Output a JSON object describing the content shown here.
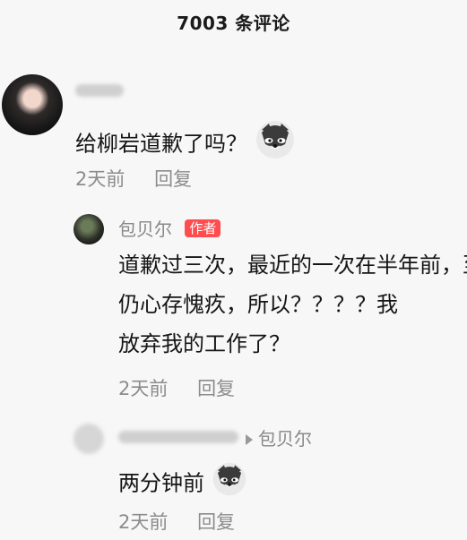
{
  "header": {
    "title": "7003 条评论"
  },
  "comments": [
    {
      "text": "给柳岩道歉了吗？",
      "time": "2天前",
      "reply_label": "回复"
    }
  ],
  "author_reply": {
    "name": "包贝尔",
    "badge": "作者",
    "line1": "道歉过三次，最近的一次在半年前，至今",
    "line2": "仍心存愧疚，所以？？？？我",
    "line3": "放弃我的工作了？",
    "time": "2天前",
    "reply_label": "回复"
  },
  "sub_reply": {
    "reply_target": "包贝尔",
    "text": "两分钟前",
    "time": "2天前",
    "reply_label": "回复"
  },
  "icons": {
    "emoji": "husky-dog-icon"
  }
}
